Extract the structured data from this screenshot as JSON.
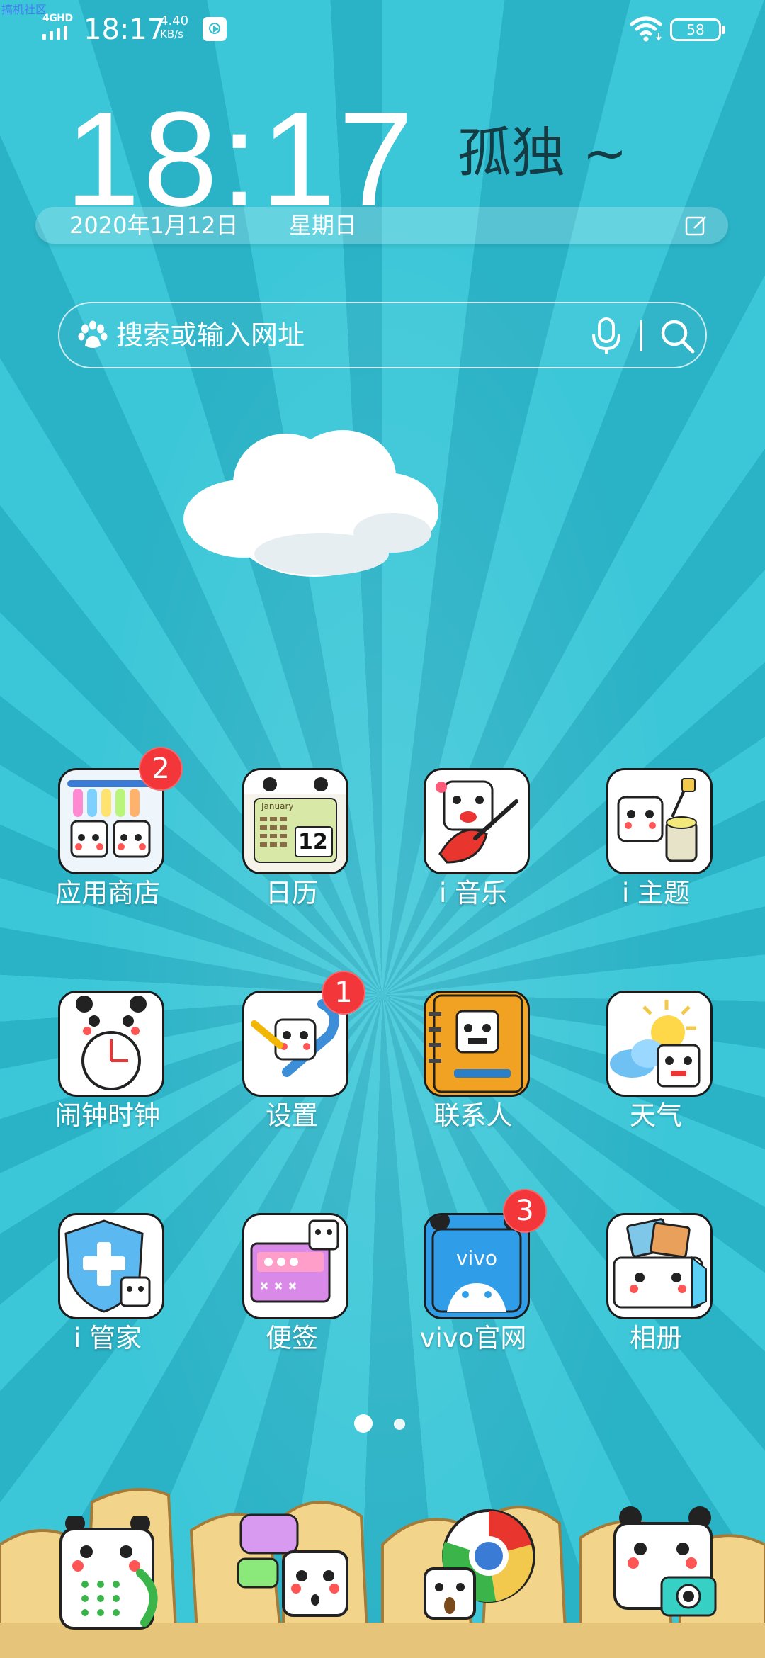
{
  "watermark": "搞机社区",
  "status_bar": {
    "network": "4GHD",
    "time": "18:17",
    "speed_value": "4.40",
    "speed_unit": "KB/s",
    "battery": "58"
  },
  "clock_widget": {
    "time": "18:17",
    "mood": "孤独 ~",
    "date": "2020年1月12日",
    "weekday": "星期日"
  },
  "search": {
    "placeholder": "搜索或输入网址"
  },
  "apps": [
    {
      "label": "应用商店",
      "badge": "2"
    },
    {
      "label": "日历",
      "badge": null,
      "calendar_month": "January",
      "calendar_day": "12"
    },
    {
      "label": "i 音乐",
      "badge": null
    },
    {
      "label": "i 主题",
      "badge": null
    },
    {
      "label": "闹钟时钟",
      "badge": null
    },
    {
      "label": "设置",
      "badge": "1"
    },
    {
      "label": "联系人",
      "badge": null
    },
    {
      "label": "天气",
      "badge": null
    },
    {
      "label": "i 管家",
      "badge": null
    },
    {
      "label": "便签",
      "badge": null
    },
    {
      "label": "vivo官网",
      "badge": "3",
      "brand": "vivo"
    },
    {
      "label": "相册",
      "badge": null
    }
  ],
  "page_indicator": {
    "pages": 2,
    "current": 1
  },
  "dock": [
    {
      "icon": "phone-icon"
    },
    {
      "icon": "messages-icon"
    },
    {
      "icon": "browser-icon"
    },
    {
      "icon": "camera-icon"
    }
  ],
  "colors": {
    "background": "#35bfd2",
    "badge": "#f2363a",
    "mood_text": "#133c45"
  }
}
